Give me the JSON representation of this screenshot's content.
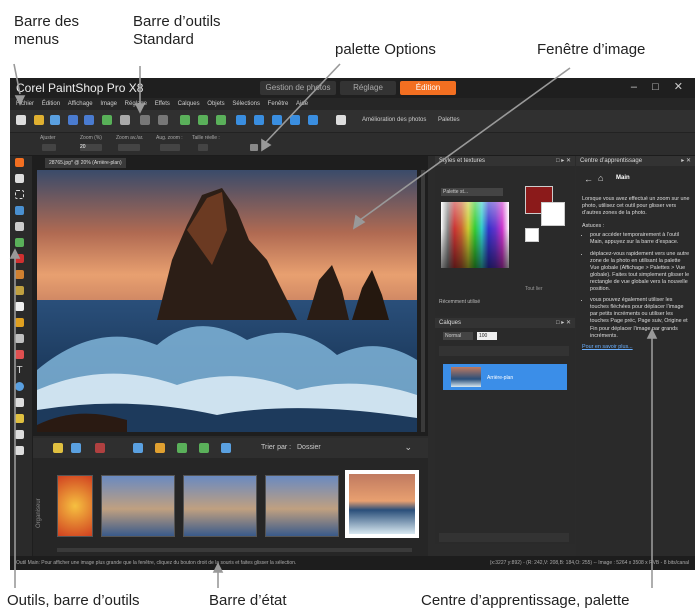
{
  "callouts": {
    "menus": "Barre des\nmenus",
    "standard": "Barre d’outils\nStandard",
    "options": "palette Options",
    "image_window": "Fenêtre d’image",
    "tools": "Outils, barre d’outils",
    "status": "Barre d’état",
    "learning": "Centre d’apprentissage, palette"
  },
  "app": {
    "title": "Corel PaintShop Pro X8",
    "workspace_tabs": [
      "Gestion de photos",
      "Réglage",
      "Édition"
    ],
    "menu": [
      "Fichier",
      "Édition",
      "Affichage",
      "Image",
      "Réglage",
      "Effets",
      "Calques",
      "Objets",
      "Sélections",
      "Fenêtre",
      "Aide"
    ],
    "std_toolbar_text": [
      "Amélioration des photos",
      "Palettes"
    ],
    "options_labels": [
      "Ajuster",
      "Zoom (%)",
      "Zoom av./ar.",
      "Aug. zoom :",
      "Taille réelle :"
    ],
    "options_value": "20",
    "image_tab": "28765.jpg* @ 20% (Arrière-plan)",
    "organizer": {
      "sort_label": "Trier par :",
      "sort_value": "Dossier",
      "vertical_label": "Organiseur"
    },
    "styles": {
      "title": "Styles et textures",
      "dropdown": "Palette st...",
      "recent": "Récemment utilisé",
      "transp": "Tout lier"
    },
    "layers": {
      "title": "Calques",
      "blend": "Normal",
      "opacity": "100",
      "layer_name": "Arrière-plan"
    },
    "learning": {
      "title": "Centre d’apprentissage",
      "section": "Main",
      "intro": "Lorsque vous avez effectué un zoom sur une photo, utilisez cet outil pour glisser vers d’autres zones de la photo.",
      "actions_label": "Astuces :",
      "bullets": [
        "pour accéder temporairement à l’outil Main, appuyez sur la barre d’espace.",
        "déplacez-vous rapidement vers une autre zone de la photo en utilisant la palette Vue globale (Affichage > Palettes > Vue globale). Faites tout simplement glisser le rectangle de vue globale vers la nouvelle position.",
        "vous pouvez également utiliser les touches fléchées pour déplacer l’image par petits incréments ou utiliser les touches Page préc, Page suiv, Origine et Fin pour déplacer l’image par grands incréments."
      ],
      "link": "Pour en savoir plus..."
    },
    "status": {
      "left": "Outil Main: Pour afficher une image plus grande que la fenêtre, cliquez du bouton droit de la souris et faites glisser la sélection.",
      "right": "(x:3227 y:892) - (R: 242,V: 208,B: 184,O: 255) -- Image : 5264 x 3508 x RVB - 8 bits/canal"
    }
  },
  "colors": {
    "accent": "#f36f21",
    "panel": "#2a2a2a",
    "selection": "#3b8ee8",
    "primary_swatch": "#8b1a1a"
  }
}
